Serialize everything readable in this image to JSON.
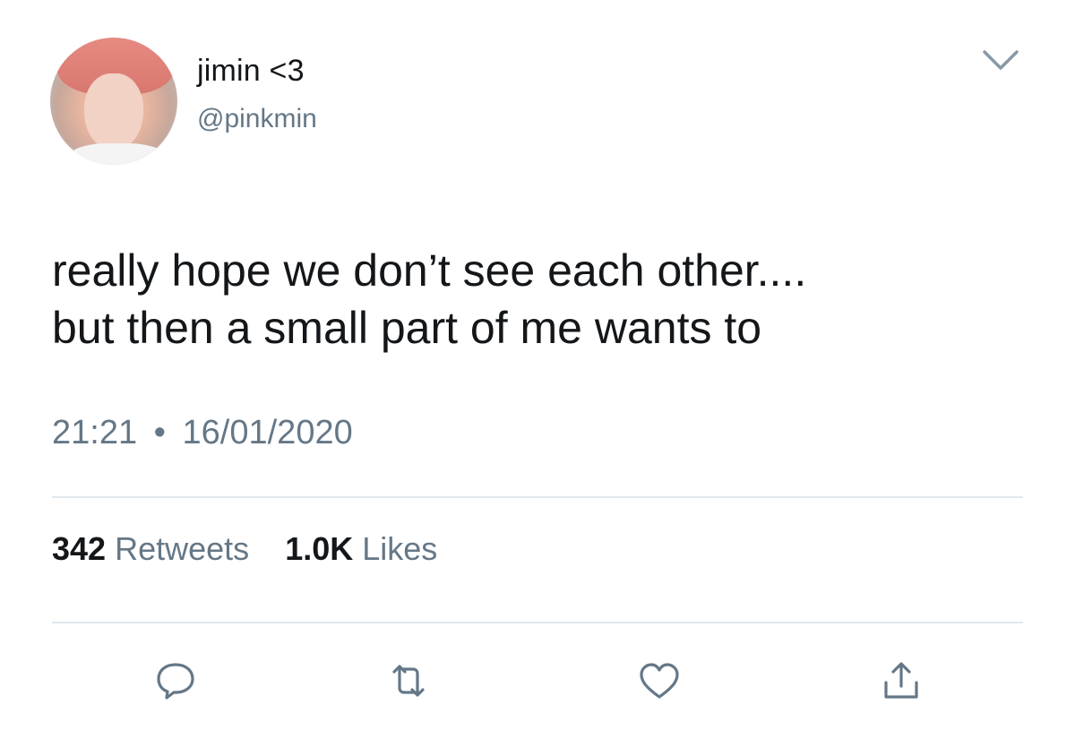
{
  "tweet": {
    "display_name": "jimin <3",
    "handle": "@pinkmin",
    "text": "really hope we don’t see each other....\nbut then a small part of me wants to",
    "time": "21:21",
    "separator": "•",
    "date": "16/01/2020",
    "retweets_count": "342",
    "retweets_label": "Retweets",
    "likes_count": "1.0K",
    "likes_label": "Likes"
  },
  "icons": {
    "menu": "chevron-down-icon",
    "reply": "reply-icon",
    "retweet": "retweet-icon",
    "like": "heart-icon",
    "share": "share-icon"
  },
  "colors": {
    "text_primary": "#14171a",
    "text_secondary": "#657786",
    "divider": "#e1e8ed",
    "icon": "#657786"
  }
}
